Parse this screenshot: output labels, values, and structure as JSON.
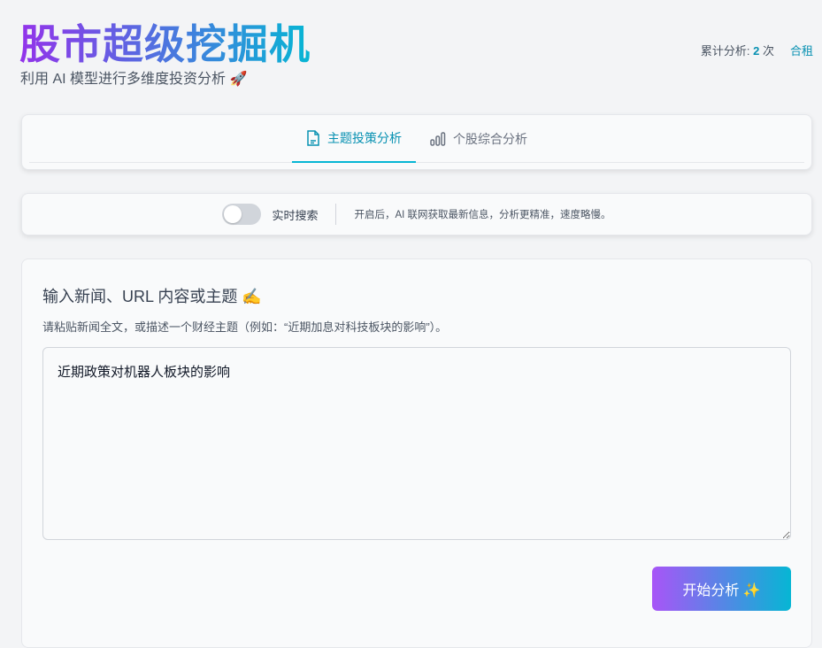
{
  "header": {
    "title": "股市超级挖掘机",
    "subtitle": "利用 AI 模型进行多维度投资分析 🚀",
    "stats_label": "累计分析:",
    "stats_count": "2",
    "stats_unit": "次",
    "link": "合租"
  },
  "tabs": [
    {
      "label": "主题投策分析",
      "icon": "document-icon",
      "active": true
    },
    {
      "label": "个股综合分析",
      "icon": "bar-chart-icon",
      "active": false
    }
  ],
  "search": {
    "toggle_label": "实时搜索",
    "toggle_on": false,
    "hint": "开启后，AI 联网获取最新信息，分析更精准，速度略慢。"
  },
  "main": {
    "heading": "输入新闻、URL 内容或主题 ✍️",
    "description": "请粘贴新闻全文，或描述一个财经主题（例如：“近期加息对科技板块的影响”）。",
    "input_value": "近期政策对机器人板块的影响",
    "button": "开始分析 ✨"
  },
  "colors": {
    "accent": "#0891b2",
    "gradient_start": "#9333ea",
    "gradient_end": "#06b6d4"
  }
}
